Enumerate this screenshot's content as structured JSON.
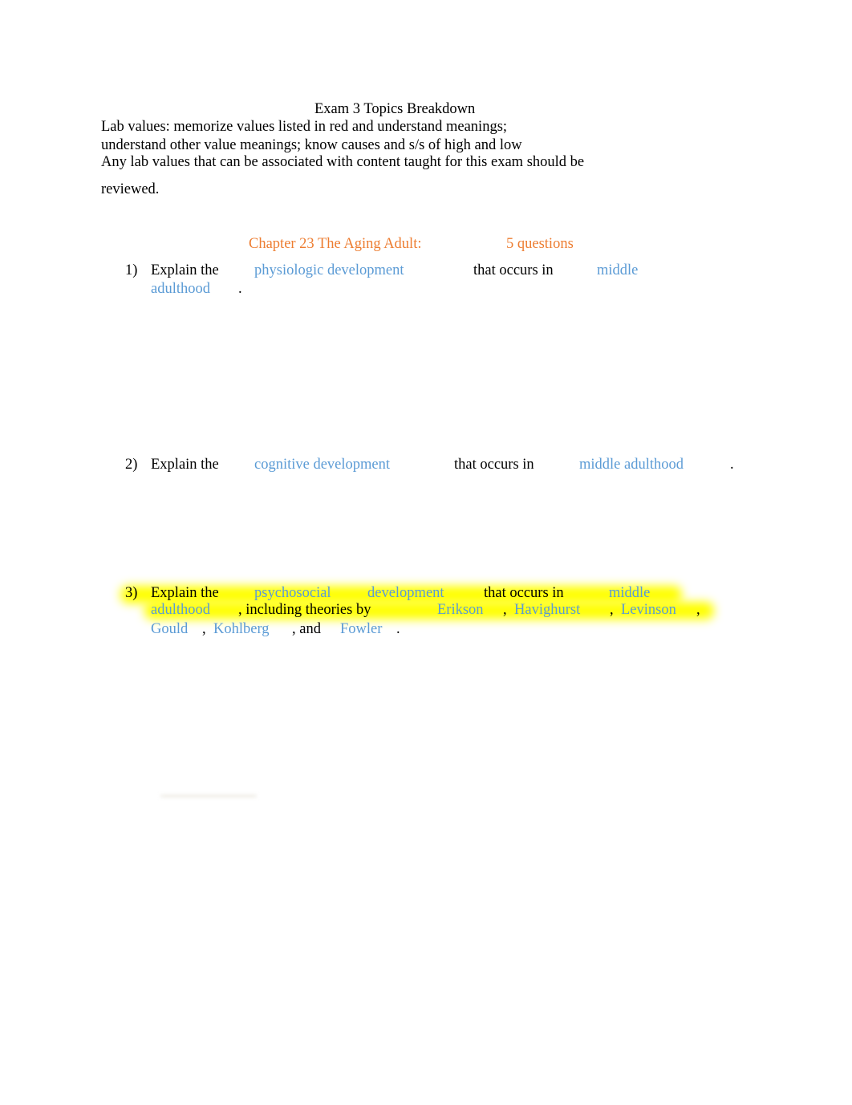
{
  "document": {
    "title": "Exam 3 Topics Breakdown",
    "intro_lines": [
      "Lab values: memorize values listed in red and understand meanings;",
      "understand other value meanings; know causes and s/s of high and low",
      "Any lab values that can be associated with content taught for this exam should be",
      "reviewed."
    ],
    "chapter": {
      "heading": "Chapter 23 The Aging Adult:",
      "question_count": "5 questions"
    },
    "colors": {
      "term_blue": "#5b9bd5",
      "heading_orange": "#ed7d31",
      "highlight_yellow": "#ffff00"
    },
    "items": [
      {
        "number": "1)",
        "lead": "Explain the",
        "topic": "physiologic development",
        "connector": "that occurs in",
        "stage_part1": "middle",
        "stage_part2": "adulthood",
        "end": "."
      },
      {
        "number": "2)",
        "lead": "Explain the",
        "topic": "cognitive development",
        "connector": "that occurs in",
        "stage": "middle adulthood",
        "end": "."
      },
      {
        "number": "3)",
        "lead": "Explain the",
        "topic_part1": "psychosocial",
        "topic_part2": "development",
        "connector": "that occurs in",
        "stage_part1": "middle",
        "stage_part2": "adulthood",
        "including": ", including theories by",
        "theorists": [
          "Erikson",
          "Havighurst",
          "Levinson",
          "Gould",
          "Kohlberg",
          "Fowler"
        ],
        "comma": ",",
        "and": ", and",
        "end": "."
      }
    ]
  }
}
